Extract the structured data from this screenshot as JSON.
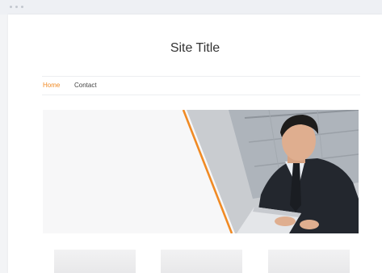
{
  "site": {
    "title": "Site Title"
  },
  "nav": {
    "items": [
      {
        "label": "Home",
        "active": true
      },
      {
        "label": "Contact",
        "active": false
      }
    ]
  },
  "hero": {
    "image": "businessman-with-laptop",
    "accent_color": "#f08a24"
  },
  "cards": [
    {
      "image": "placeholder"
    },
    {
      "image": "placeholder"
    },
    {
      "image": "placeholder"
    }
  ]
}
